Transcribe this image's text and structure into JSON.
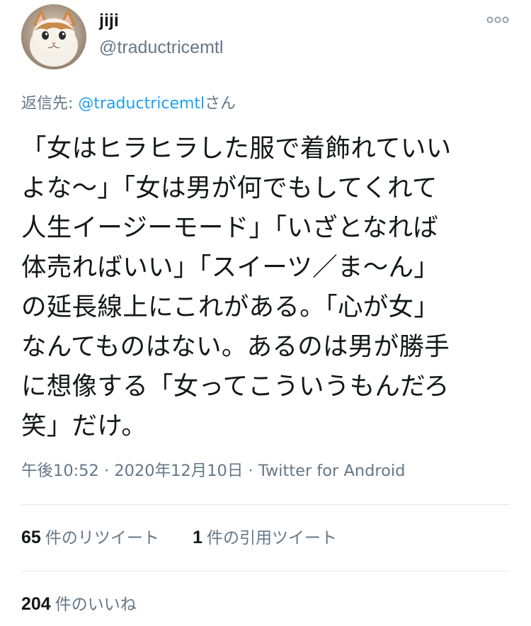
{
  "author": {
    "display_name": "jiji",
    "handle": "@traductricemtl",
    "avatar_icon": "cat-avatar"
  },
  "more_icon": "more-options-icon",
  "reply_to": {
    "prefix": "返信先: ",
    "mention": "@traductricemtl",
    "suffix": "さん"
  },
  "tweet": {
    "lines": [
      "「女はヒラヒラした服で着飾れていい",
      "よな〜」「女は男が何でもしてくれて",
      "人生イージーモード」「いざとなれば",
      "体売ればいい」「スイーツ／ま〜ん」",
      "の延長線上にこれがある。「心が女」",
      "なんてものはない。あるのは男が勝手",
      "に想像する「女ってこういうもんだろ",
      "笑」だけ。"
    ]
  },
  "meta": {
    "time": "午後10:52",
    "sep1": " · ",
    "date": "2020年12月10日",
    "sep2": " · ",
    "app": "Twitter for Android"
  },
  "stats": {
    "retweets": {
      "count": "65",
      "label": "件のリツイート"
    },
    "quotes": {
      "count": "1",
      "label": "件の引用ツイート"
    },
    "likes": {
      "count": "204",
      "label": "件のいいね"
    }
  },
  "colors": {
    "text": "#14171a",
    "secondary": "#657786",
    "link": "#1da1f2",
    "divider": "#e1e8ed"
  }
}
